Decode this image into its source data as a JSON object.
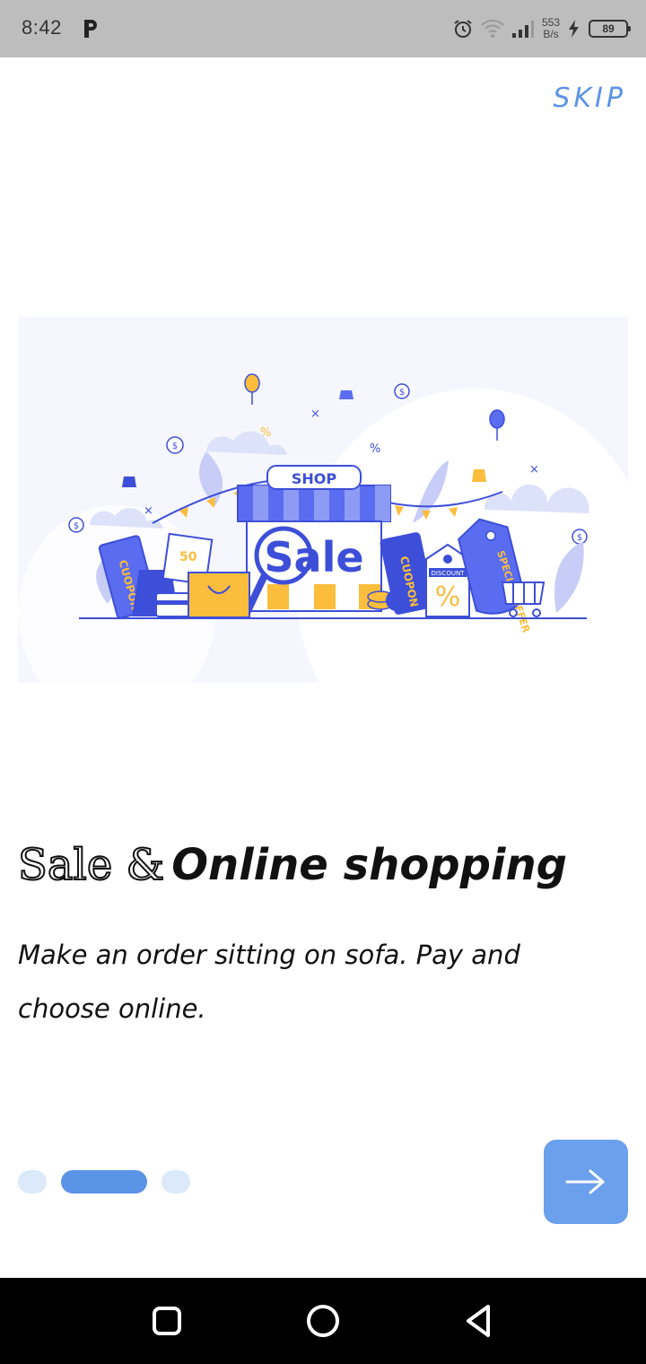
{
  "status_bar": {
    "time": "8:42",
    "net_speed_value": "553",
    "net_speed_unit": "B/s",
    "battery": "89"
  },
  "onboarding": {
    "skip_label": "SKIP",
    "illustration": {
      "shop_sign": "SHOP",
      "sale_text": "Sale",
      "coupon_text": "CUOPON",
      "discount_text": "DISCOUNT",
      "percent_text": "%",
      "special_offer_text": "SPECIAL OFFER",
      "voucher_value": "50"
    },
    "title_outline": "Sale &",
    "title_bold": "Online shopping",
    "subtitle": "Make an order sitting on sofa. Pay and choose online.",
    "page_count": 3,
    "current_page": 2
  },
  "colors": {
    "accent": "#5b93e6",
    "next_button": "#6aa0ec",
    "dot_inactive": "#dce9fb",
    "illustration_blue": "#3d4fd8",
    "illustration_yellow": "#fbbd3c"
  },
  "icons": {
    "next": "arrow-right-icon",
    "nav_recents": "square-icon",
    "nav_home": "circle-icon",
    "nav_back": "triangle-back-icon"
  }
}
